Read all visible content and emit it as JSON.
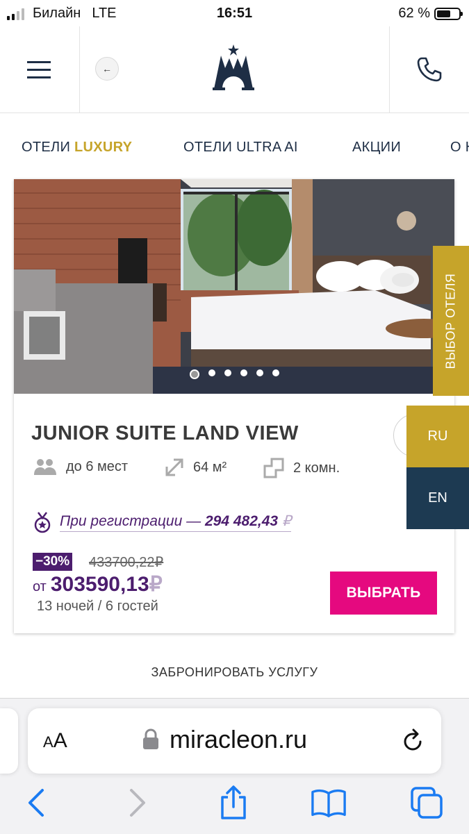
{
  "status_bar": {
    "carrier": "Билайн",
    "network": "LTE",
    "time": "16:51",
    "battery": "62 %",
    "battery_level": 0.62
  },
  "header": {
    "menu_icon": "hamburger-icon",
    "back_icon": "←",
    "logo_icon": "castle-logo",
    "phone_icon": "phone-icon"
  },
  "nav": {
    "items": [
      {
        "label": "ОТЕЛИ",
        "accent": "LUXURY"
      },
      {
        "label": "ОТЕЛИ ULTRA AI"
      },
      {
        "label": "АКЦИИ"
      },
      {
        "label": "О Н"
      }
    ]
  },
  "room": {
    "title": "JUNIOR SUITE LAND VIEW",
    "guests": "до 6 мест",
    "area": "64 м²",
    "rooms": "2 комн.",
    "promo_text": "При регистрации —",
    "promo_price": "294 482,43",
    "promo_currency": "₽",
    "discount": "−30%",
    "old_price": "433700,22₽",
    "price_from": "от",
    "price": "303590,13",
    "currency": "₽",
    "nights": "13 ночей / 6 гостей",
    "choose": "ВЫБРАТЬ",
    "slides": 6,
    "active_slide": 1
  },
  "side": {
    "hotel_select": "ВЫБОР ОТЕЛЯ",
    "lang_ru": "RU",
    "lang_en": "EN"
  },
  "footer": {
    "book_service": "ЗАБРОНИРОВАТЬ УСЛУГУ"
  },
  "safari": {
    "aa_big": "A",
    "aa_small": "A",
    "url": "miracleon.ru"
  },
  "colors": {
    "gold": "#c6a42a",
    "purple": "#4c1d6e",
    "pink": "#e5097f",
    "navy": "#1d3a52",
    "ios_blue": "#1a7bf2"
  }
}
